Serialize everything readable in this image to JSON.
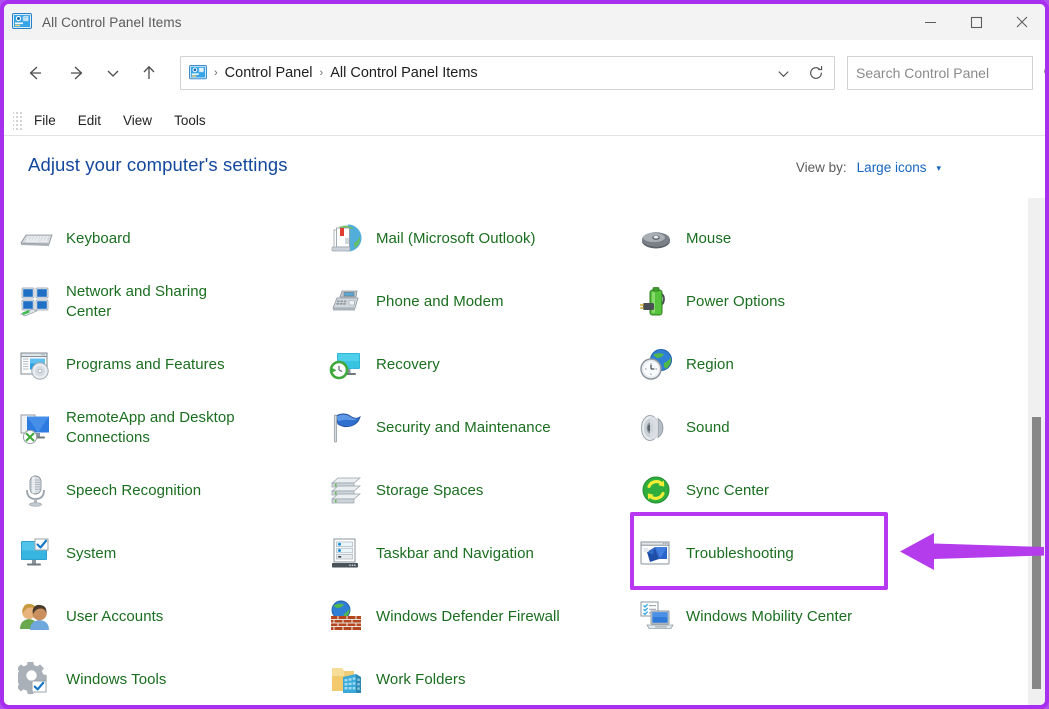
{
  "window": {
    "title": "All Control Panel Items",
    "app_icon": "control-panel-icon",
    "minimize_label": "Minimize",
    "maximize_label": "Maximize",
    "close_label": "Close"
  },
  "nav": {
    "back_label": "Back",
    "forward_label": "Forward",
    "recent_label": "Recent locations",
    "up_label": "Up",
    "refresh_label": "Refresh",
    "dropdown_label": "Previous locations"
  },
  "address": {
    "icon": "control-panel-icon",
    "separator": "›",
    "crumbs": [
      "Control Panel",
      "All Control Panel Items"
    ]
  },
  "search": {
    "placeholder": "Search Control Panel",
    "value": "",
    "icon": "search-icon"
  },
  "menu": {
    "items": [
      "File",
      "Edit",
      "View",
      "Tools"
    ]
  },
  "page": {
    "title": "Adjust your computer's settings",
    "view_by_label": "View by:",
    "view_by_value": "Large icons",
    "view_by_caret": "▾"
  },
  "items": [
    {
      "label": "Keyboard",
      "icon": "keyboard-icon"
    },
    {
      "label": "Mail (Microsoft Outlook)",
      "icon": "mail-icon"
    },
    {
      "label": "Mouse",
      "icon": "mouse-icon"
    },
    {
      "label": "Network and Sharing Center",
      "icon": "network-sharing-icon"
    },
    {
      "label": "Phone and Modem",
      "icon": "phone-modem-icon"
    },
    {
      "label": "Power Options",
      "icon": "power-options-icon"
    },
    {
      "label": "Programs and Features",
      "icon": "programs-features-icon"
    },
    {
      "label": "Recovery",
      "icon": "recovery-icon"
    },
    {
      "label": "Region",
      "icon": "region-icon"
    },
    {
      "label": "RemoteApp and Desktop Connections",
      "icon": "remoteapp-icon"
    },
    {
      "label": "Security and Maintenance",
      "icon": "security-maintenance-icon"
    },
    {
      "label": "Sound",
      "icon": "sound-icon"
    },
    {
      "label": "Speech Recognition",
      "icon": "speech-recognition-icon"
    },
    {
      "label": "Storage Spaces",
      "icon": "storage-spaces-icon"
    },
    {
      "label": "Sync Center",
      "icon": "sync-center-icon"
    },
    {
      "label": "System",
      "icon": "system-icon"
    },
    {
      "label": "Taskbar and Navigation",
      "icon": "taskbar-navigation-icon"
    },
    {
      "label": "Troubleshooting",
      "icon": "troubleshooting-icon"
    },
    {
      "label": "User Accounts",
      "icon": "user-accounts-icon"
    },
    {
      "label": "Windows Defender Firewall",
      "icon": "windows-defender-firewall-icon"
    },
    {
      "label": "Windows Mobility Center",
      "icon": "windows-mobility-center-icon"
    },
    {
      "label": "Windows Tools",
      "icon": "windows-tools-icon"
    },
    {
      "label": "Work Folders",
      "icon": "work-folders-icon"
    }
  ],
  "annotation": {
    "highlight_target": "Troubleshooting",
    "highlight_color": "#b837f2",
    "arrow_color": "#b43ced",
    "frame_color": "#a72ff0"
  },
  "colors": {
    "item_text": "#1a6e1f",
    "page_title": "#14489e",
    "link": "#1565c0",
    "titlebar_bg": "#f3f3f3"
  }
}
